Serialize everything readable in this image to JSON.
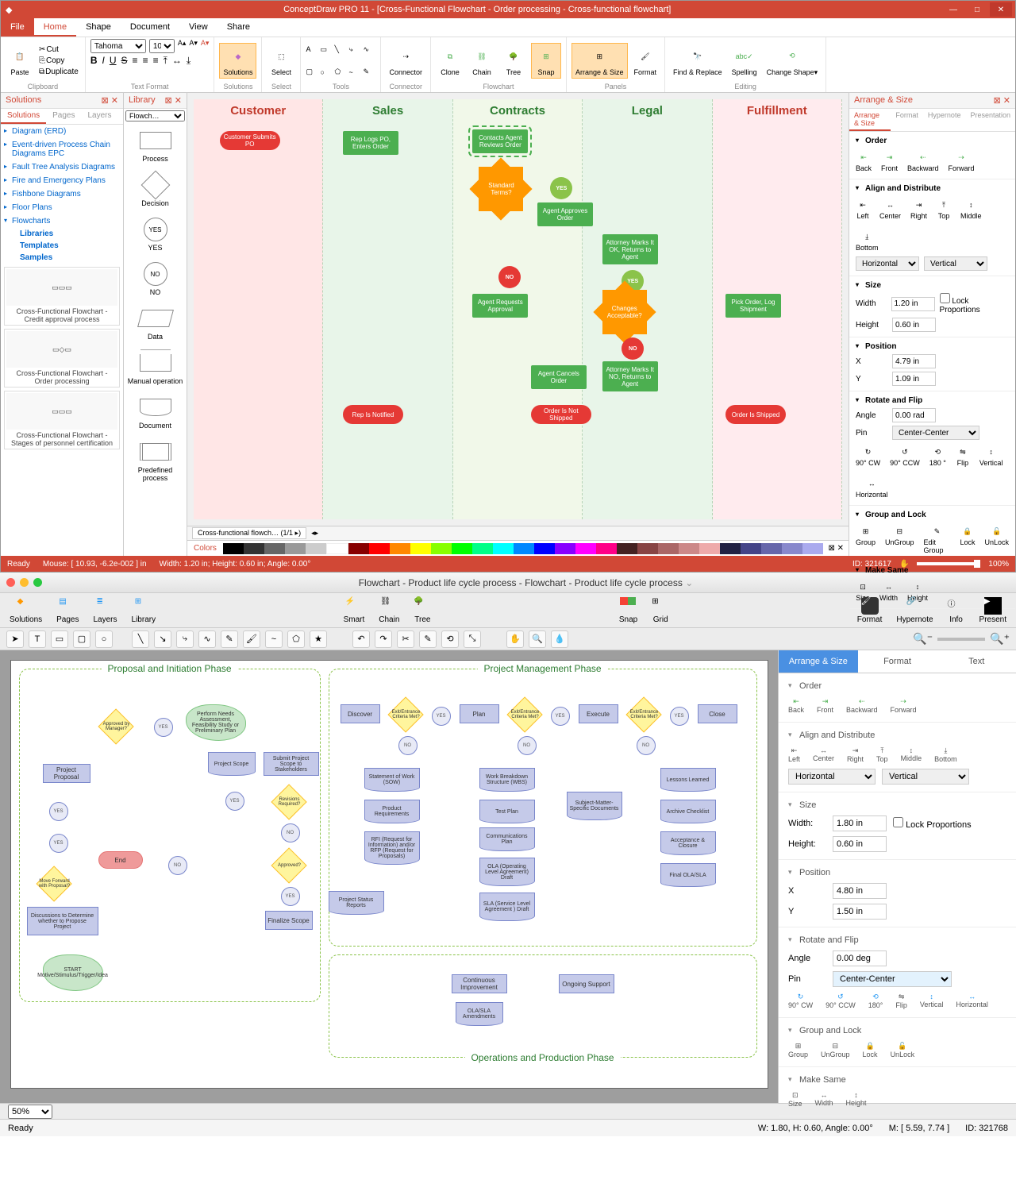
{
  "win": {
    "title": "ConceptDraw PRO 11 - [Cross-Functional Flowchart - Order processing - Cross-functional flowchart]",
    "menu": [
      "File",
      "Home",
      "Shape",
      "Document",
      "View",
      "Share"
    ],
    "font_name": "Tahoma",
    "font_size": "10",
    "ribbon_groups": {
      "clipboard": "Clipboard",
      "textfmt": "Text Format",
      "solutions": "Solutions",
      "select": "Select",
      "tools": "Tools",
      "connector": "Connector",
      "flowchart": "Flowchart",
      "panels": "Panels",
      "editing": "Editing"
    },
    "ribbon_btns": {
      "paste": "Paste",
      "cut": "Cut",
      "copy": "Copy",
      "duplicate": "Duplicate",
      "solutions": "Solutions",
      "select": "Select",
      "connector": "Connector",
      "clone": "Clone",
      "chain": "Chain",
      "tree": "Tree",
      "snap": "Snap",
      "arrange": "Arrange & Size",
      "format": "Format",
      "find": "Find & Replace",
      "spelling": "Spelling",
      "change": "Change Shape▾"
    },
    "left_pane": {
      "title": "Solutions",
      "tabs": [
        "Solutions",
        "Pages",
        "Layers"
      ],
      "tree": [
        "Diagram (ERD)",
        "Event-driven Process Chain Diagrams EPC",
        "Fault Tree Analysis Diagrams",
        "Fire and Emergency Plans",
        "Fishbone Diagrams",
        "Floor Plans",
        "Flowcharts"
      ],
      "subtree": [
        "Libraries",
        "Templates",
        "Samples"
      ],
      "samples": [
        "Cross-Functional Flowchart - Credit approval process",
        "Cross-Functional Flowchart - Order processing",
        "Cross-Functional Flowchart - Stages of personnel certification"
      ]
    },
    "library": {
      "title": "Library",
      "dropdown": "Flowch…",
      "shapes": [
        "Process",
        "Decision",
        "YES",
        "NO",
        "Data",
        "Manual operation",
        "Document",
        "Predefined process"
      ]
    },
    "canvas": {
      "lanes": [
        "Customer",
        "Sales",
        "Contracts",
        "Legal",
        "Fulfillment"
      ],
      "shapes": {
        "customer_submit": "Customer Submits PO",
        "rep_logs": "Rep Logs PO, Enters Order",
        "contacts_agent": "Contacts Agent Reviews Order",
        "standard_terms": "Standard Terms?",
        "agent_approves": "Agent Approves Order",
        "attorney_ok": "Attorney Marks It OK, Returns to Agent",
        "agent_requests": "Agent Requests Approval",
        "changes_acceptable": "Changes Acceptable?",
        "pick_order": "Pick Order, Log Shipment",
        "attorney_no": "Attorney Marks It NO, Returns to Agent",
        "agent_cancels": "Agent Cancels Order",
        "rep_notified": "Rep Is Notified",
        "not_shipped": "Order Is Not Shipped",
        "shipped": "Order Is Shipped",
        "yes": "YES",
        "no": "NO"
      },
      "page_tab": "Cross-functional flowch…  (1/1 ▸)"
    },
    "colors_label": "Colors",
    "right_pane": {
      "title": "Arrange & Size",
      "tabs": [
        "Arrange & Size",
        "Format",
        "Hypernote",
        "Presentation"
      ],
      "sections": {
        "order": "Order",
        "align": "Align and Distribute",
        "size": "Size",
        "position": "Position",
        "rotate": "Rotate and Flip",
        "group": "Group and Lock",
        "makesame": "Make Same"
      },
      "order_btns": [
        "Back",
        "Front",
        "Backward",
        "Forward"
      ],
      "align_btns": [
        "Left",
        "Center",
        "Right",
        "Top",
        "Middle",
        "Bottom"
      ],
      "align_h": "Horizontal",
      "align_v": "Vertical",
      "width_label": "Width",
      "width_val": "1.20 in",
      "height_label": "Height",
      "height_val": "0.60 in",
      "lock_prop": "Lock Proportions",
      "x_label": "X",
      "x_val": "4.79 in",
      "y_label": "Y",
      "y_val": "1.09 in",
      "angle_label": "Angle",
      "angle_val": "0.00 rad",
      "pin_label": "Pin",
      "pin_val": "Center-Center",
      "rotate_btns": [
        "90° CW",
        "90° CCW",
        "180 °",
        "Flip",
        "Vertical",
        "Horizontal"
      ],
      "group_btns": [
        "Group",
        "UnGroup",
        "Edit Group",
        "Lock",
        "UnLock"
      ],
      "same_btns": [
        "Size",
        "Width",
        "Height"
      ]
    },
    "status": {
      "ready": "Ready",
      "mouse": "Mouse: [ 10.93, -6.2e-002 ] in",
      "dims": "Width: 1.20 in;  Height: 0.60 in;  Angle: 0.00°",
      "id": "ID: 321617",
      "zoom": "100%"
    }
  },
  "mac": {
    "title": "Flowchart - Product life cycle process - Flowchart - Product life cycle process",
    "toolbar": [
      "Solutions",
      "Pages",
      "Layers",
      "Library",
      "Smart",
      "Chain",
      "Tree",
      "Snap",
      "Grid",
      "Format",
      "Hypernote",
      "Info",
      "Present"
    ],
    "phases": {
      "proposal": "Proposal and Initiation Phase",
      "project": "Project Management Phase",
      "ops": "Operations and Production Phase"
    },
    "shapes": {
      "start": "START Motive/Stimulus/Trigger/Idea",
      "discuss": "Discussions to Determine whether to Propose Project",
      "move_fwd": "Move Forward with Proposal?",
      "proj_proposal": "Project Proposal",
      "approved_mgr": "Approved by Manager?",
      "needs": "Perform Needs Assessment, Feasibility Study or Preliminary Plan",
      "scope": "Project Scope",
      "submit_scope": "Submit Project Scope to Stakeholders",
      "revisions": "Revisions Required?",
      "approved": "Approved?",
      "finalize": "Finalize Scope",
      "end": "End",
      "discover": "Discover",
      "exit1": "Exit/Entrance Criteria Met?",
      "plan": "Plan",
      "exit2": "Exit/Entrance Criteria Met?",
      "execute": "Execute",
      "exit3": "Exit/Entrance Criteria Met?",
      "close": "Close",
      "sow": "Statement of Work (SOW)",
      "prodreq": "Product Requirements",
      "rfi": "RFI (Request for Information) and/or RFP (Request for Proposals)",
      "status_rpt": "Project Status Reports",
      "wbs": "Work Breakdown Structure (WBS)",
      "testplan": "Test Plan",
      "commplan": "Communications Plan",
      "ola": "OLA (Operating Level Agreement) Draft",
      "sla": "SLA (Service Level Agreement ) Draft",
      "subject": "Subject-Matter-Specific Documents",
      "lessons": "Lessons Learned",
      "archive": "Archive Checklist",
      "accept": "Acceptance & Closure",
      "final": "Final OLA/SLA",
      "continuous": "Continuous Improvement",
      "olaamend": "OLA/SLA Amendments",
      "ongoing": "Ongoing Support",
      "yes": "YES",
      "no": "NO"
    },
    "right": {
      "tabs": [
        "Arrange & Size",
        "Format",
        "Text"
      ],
      "order": "Order",
      "order_btns": [
        "Back",
        "Front",
        "Backward",
        "Forward"
      ],
      "align": "Align and Distribute",
      "align_btns": [
        "Left",
        "Center",
        "Right",
        "Top",
        "Middle",
        "Bottom"
      ],
      "align_h": "Horizontal",
      "align_v": "Vertical",
      "size": "Size",
      "width_label": "Width:",
      "width_val": "1.80 in",
      "height_label": "Height:",
      "height_val": "0.60 in",
      "lock": "Lock Proportions",
      "position": "Position",
      "x_label": "X",
      "x_val": "4.80 in",
      "y_label": "Y",
      "y_val": "1.50 in",
      "rotate": "Rotate and Flip",
      "angle_label": "Angle",
      "angle_val": "0.00 deg",
      "pin_label": "Pin",
      "pin_val": "Center-Center",
      "rotate_btns": [
        "90° CW",
        "90° CCW",
        "180°",
        "Flip",
        "Vertical",
        "Horizontal"
      ],
      "group": "Group and Lock",
      "group_btns": [
        "Group",
        "UnGroup",
        "Lock",
        "UnLock"
      ],
      "same": "Make Same",
      "same_btns": [
        "Size",
        "Width",
        "Height"
      ]
    },
    "status": {
      "zoom": "50%",
      "ready": "Ready",
      "dims": "W: 1.80,  H: 0.60,  Angle: 0.00°",
      "mouse": "M: [ 5.59, 7.74 ]",
      "id": "ID: 321768"
    }
  }
}
